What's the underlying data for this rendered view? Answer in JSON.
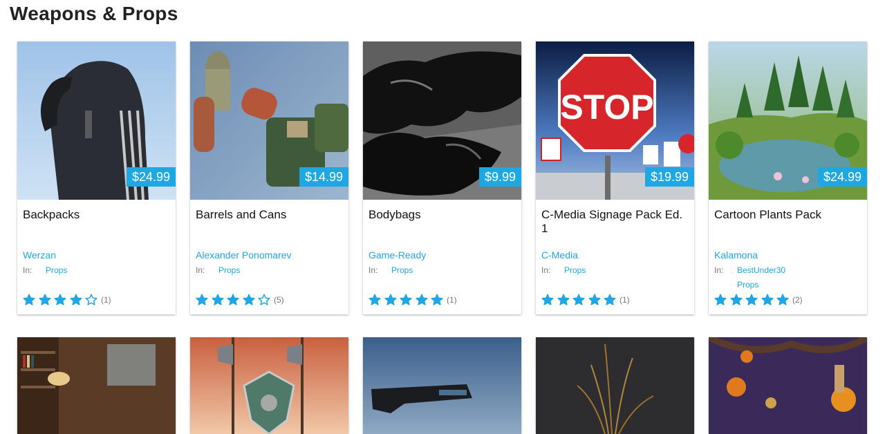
{
  "page": {
    "title": "Weapons & Props"
  },
  "cards": [
    {
      "name": "Backpacks",
      "author": "Werzan",
      "in_label": "In:",
      "categories": [
        "Props"
      ],
      "price": "$24.99",
      "rating": 4,
      "count": "(1)",
      "icon": "backpack-image"
    },
    {
      "name": "Barrels and Cans",
      "author": "Alexander Ponomarev",
      "in_label": "In:",
      "categories": [
        "Props"
      ],
      "price": "$14.99",
      "rating": 4,
      "count": "(5)",
      "icon": "barrels-image"
    },
    {
      "name": "Bodybags",
      "author": "Game-Ready",
      "in_label": "In:",
      "categories": [
        "Props"
      ],
      "price": "$9.99",
      "rating": 5,
      "count": "(1)",
      "icon": "bodybag-image"
    },
    {
      "name": "C-Media Signage Pack Ed. 1",
      "author": "C-Media",
      "in_label": "In:",
      "categories": [
        "Props"
      ],
      "price": "$19.99",
      "rating": 5,
      "count": "(1)",
      "icon": "stop-sign-image"
    },
    {
      "name": "Cartoon Plants Pack",
      "author": "Kalamona",
      "in_label": "In:",
      "categories": [
        "BestUnder30",
        "Props"
      ],
      "price": "$24.99",
      "rating": 5,
      "count": "(2)",
      "icon": "cartoon-forest-image"
    }
  ],
  "second_row": [
    {
      "icon": "library-room-image"
    },
    {
      "icon": "fantasy-axes-image"
    },
    {
      "icon": "pistol-image"
    },
    {
      "icon": "dry-grass-image"
    },
    {
      "icon": "halloween-tree-image"
    }
  ],
  "colors": {
    "accent": "#1ea7e2",
    "star": "#1ea7e2"
  }
}
